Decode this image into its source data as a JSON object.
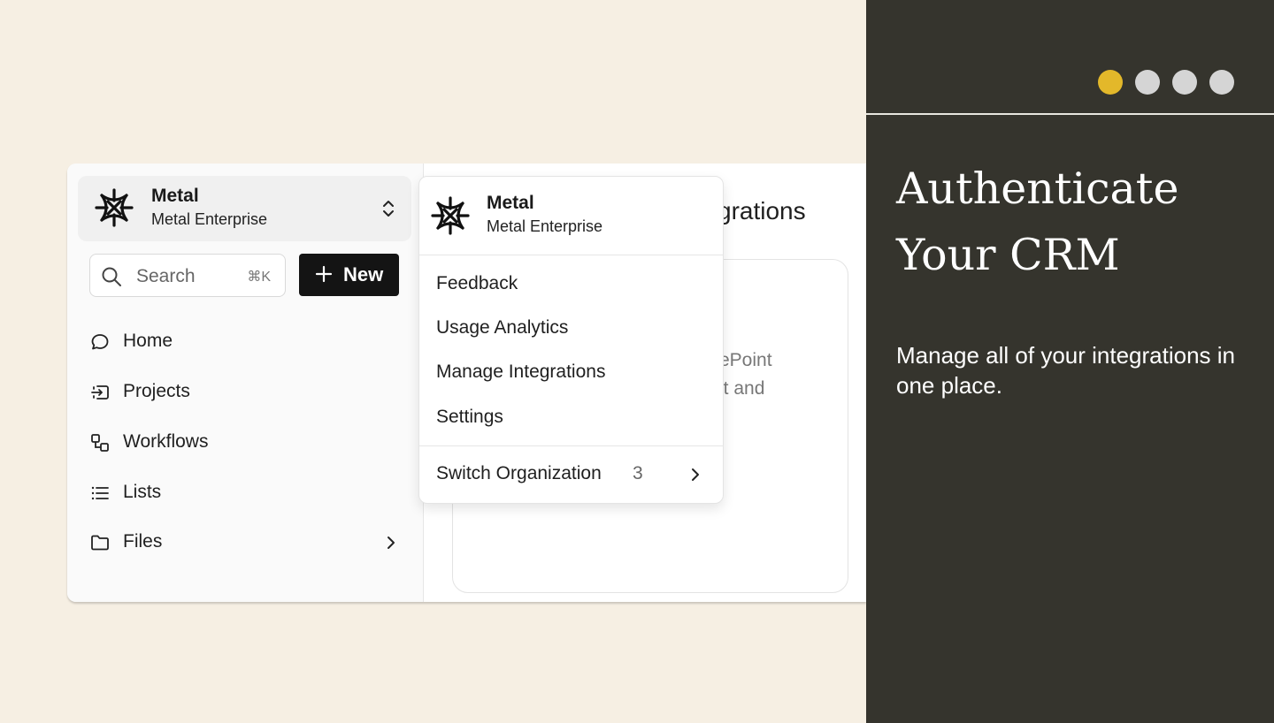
{
  "org": {
    "name": "Metal",
    "subtitle": "Metal Enterprise"
  },
  "search": {
    "placeholder": "Search",
    "shortcut": "⌘K"
  },
  "new_button": {
    "label": "New"
  },
  "nav": [
    {
      "label": "Home",
      "icon": "chat-bubble-icon"
    },
    {
      "label": "Projects",
      "icon": "inbox-arrow-icon"
    },
    {
      "label": "Workflows",
      "icon": "workflow-icon"
    },
    {
      "label": "Lists",
      "icon": "list-icon"
    },
    {
      "label": "Files",
      "icon": "folder-icon"
    }
  ],
  "main": {
    "title_fragment": "grations",
    "card_line1": "rePoint",
    "card_line2": "nt and"
  },
  "dropdown": {
    "org_name": "Metal",
    "org_subtitle": "Metal Enterprise",
    "items": [
      "Feedback",
      "Usage Analytics",
      "Manage Integrations",
      "Settings"
    ],
    "switch_label": "Switch Organization",
    "switch_count": "3"
  },
  "panel": {
    "headline_line1": "Authenticate",
    "headline_line2": "Your CRM",
    "description": "Manage all of your integrations in one place.",
    "dots_total": 4,
    "dots_active_index": 0,
    "accent_color": "#e3b82a",
    "background_color": "#35342d"
  }
}
